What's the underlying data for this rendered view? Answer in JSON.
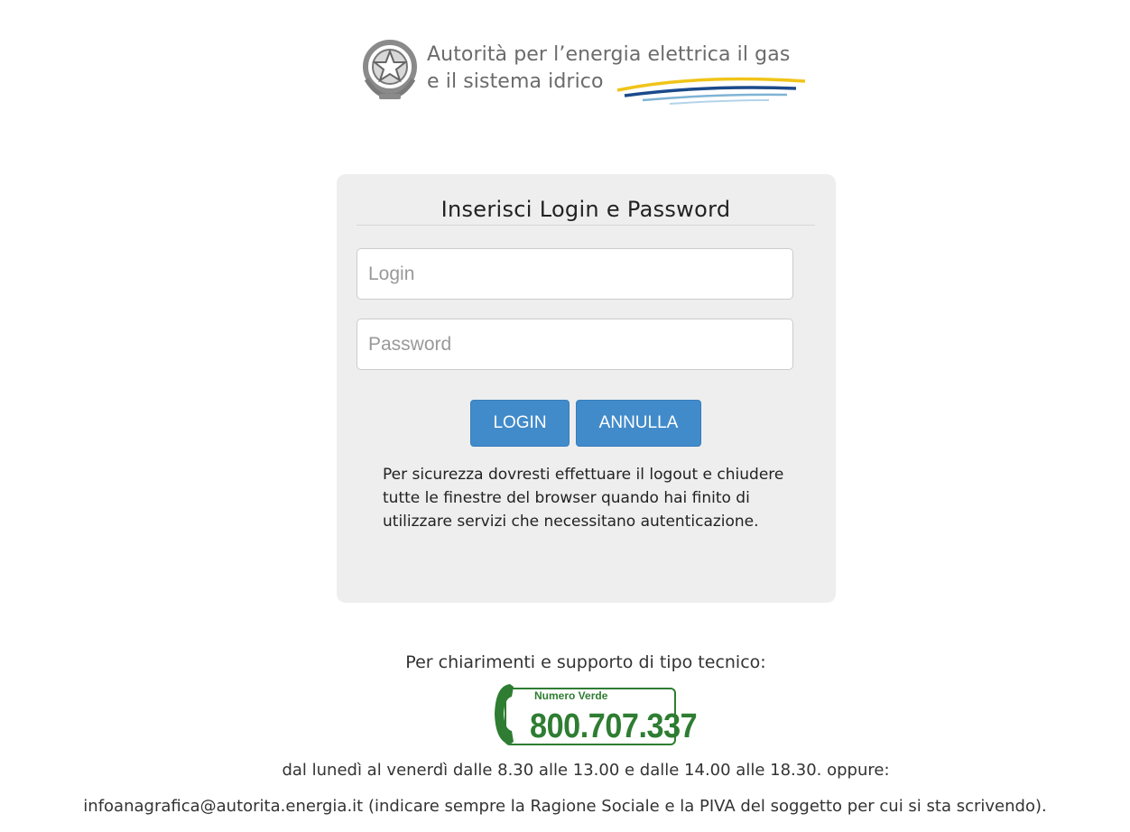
{
  "header": {
    "org_name_line1": "Autorità per l’energia elettrica il gas",
    "org_name_line2": "e il sistema idrico",
    "emblem_icon": "italian-republic-emblem-icon",
    "waves_colors": [
      "#f0c419",
      "#1b4a8c",
      "#7fb3d5"
    ]
  },
  "login_panel": {
    "title": "Inserisci Login e Password",
    "login_field": {
      "placeholder": "Login",
      "value": ""
    },
    "password_field": {
      "placeholder": "Password",
      "value": ""
    },
    "login_button": "LOGIN",
    "cancel_button": "ANNULLA",
    "security_note": "Per sicurezza dovresti effettuare il logout e chiudere tutte le finestre del browser quando hai finito di utilizzare servizi che necessitano autenticazione."
  },
  "support": {
    "title": "Per chiarimenti e supporto di tipo tecnico:",
    "toll_free_label": "Numero Verde",
    "phone_number": "800.707.337",
    "phone_icon": "telephone-handset-icon",
    "hours": "dal lunedì al venerdì dalle 8.30 alle 13.00 e dalle 14.00 alle 18.30. oppure:",
    "email": "infoanagrafica@autorita.energia.it",
    "email_note": " (indicare sempre la Ragione Sociale e la PIVA del soggetto per cui si sta scrivendo)."
  },
  "colors": {
    "button_bg": "#428bca",
    "panel_bg": "#eeeeee",
    "toll_free_green": "#2e7d32"
  }
}
